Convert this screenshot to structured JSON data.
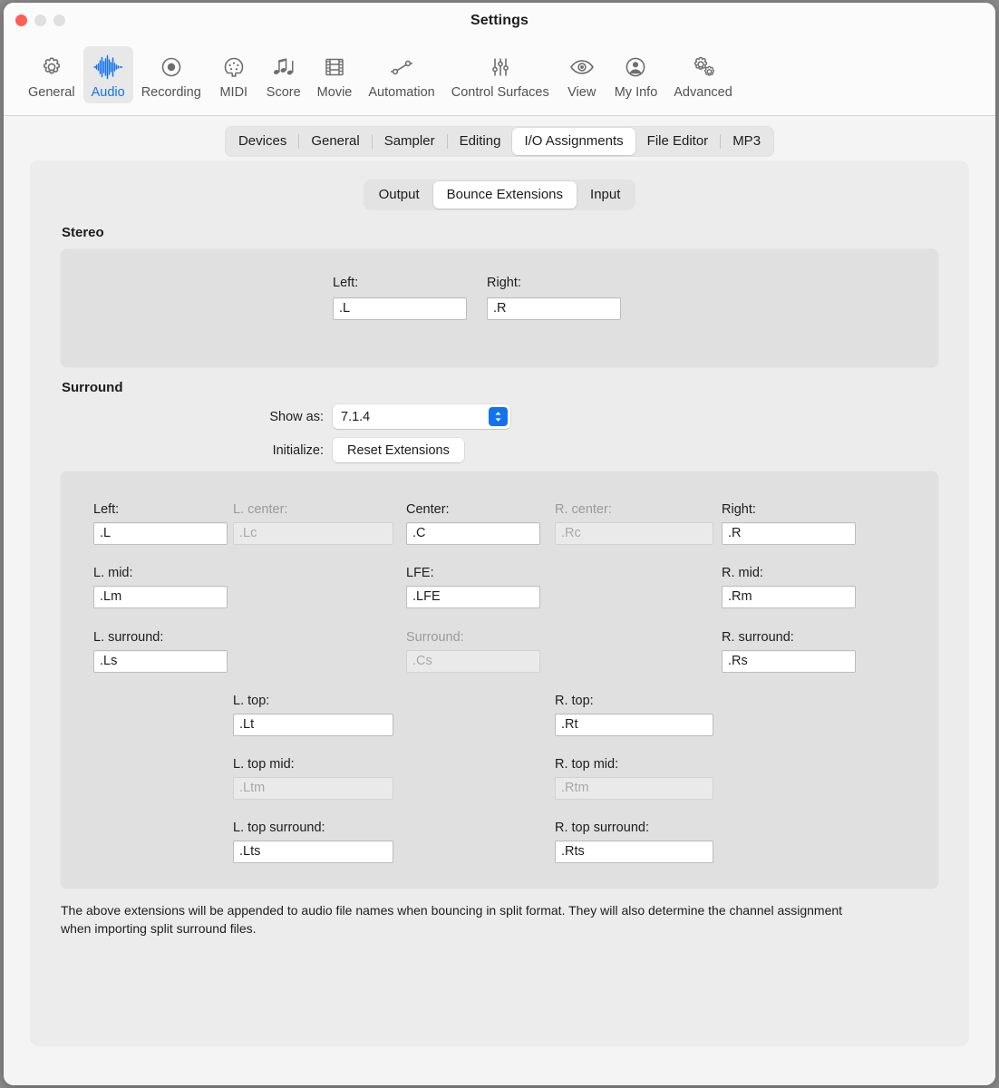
{
  "window": {
    "title": "Settings",
    "traffic_lights": [
      "close-button",
      "minimize-button",
      "zoom-button"
    ]
  },
  "toolbar": {
    "items": [
      {
        "label": "General",
        "icon": "gear-icon",
        "selected": false
      },
      {
        "label": "Audio",
        "icon": "waveform-icon",
        "selected": true
      },
      {
        "label": "Recording",
        "icon": "record-circle-icon",
        "selected": false
      },
      {
        "label": "MIDI",
        "icon": "midi-connector-icon",
        "selected": false
      },
      {
        "label": "Score",
        "icon": "music-notes-icon",
        "selected": false
      },
      {
        "label": "Movie",
        "icon": "film-strip-icon",
        "selected": false
      },
      {
        "label": "Automation",
        "icon": "automation-nodes-icon",
        "selected": false
      },
      {
        "label": "Control Surfaces",
        "icon": "sliders-icon",
        "selected": false
      },
      {
        "label": "View",
        "icon": "eye-icon",
        "selected": false
      },
      {
        "label": "My Info",
        "icon": "person-circle-icon",
        "selected": false
      },
      {
        "label": "Advanced",
        "icon": "double-gear-icon",
        "selected": false
      }
    ]
  },
  "top_tabs": {
    "items": [
      {
        "label": "Devices",
        "selected": false
      },
      {
        "label": "General",
        "selected": false
      },
      {
        "label": "Sampler",
        "selected": false
      },
      {
        "label": "Editing",
        "selected": false
      },
      {
        "label": "I/O Assignments",
        "selected": true
      },
      {
        "label": "File Editor",
        "selected": false
      },
      {
        "label": "MP3",
        "selected": false
      }
    ]
  },
  "sub_tabs": {
    "items": [
      {
        "label": "Output",
        "selected": false
      },
      {
        "label": "Bounce Extensions",
        "selected": true
      },
      {
        "label": "Input",
        "selected": false
      }
    ]
  },
  "stereo": {
    "title": "Stereo",
    "left": {
      "label": "Left:",
      "value": ".L",
      "enabled": true
    },
    "right": {
      "label": "Right:",
      "value": ".R",
      "enabled": true
    }
  },
  "surround": {
    "title": "Surround",
    "show_as": {
      "label": "Show as:",
      "value": "7.1.4"
    },
    "initialize": {
      "label": "Initialize:",
      "button": "Reset Extensions"
    },
    "fields": [
      {
        "key": "left",
        "label": "Left:",
        "value": ".L",
        "enabled": true
      },
      {
        "key": "l_center",
        "label": "L. center:",
        "value": ".Lc",
        "enabled": false
      },
      {
        "key": "center",
        "label": "Center:",
        "value": ".C",
        "enabled": true
      },
      {
        "key": "r_center",
        "label": "R. center:",
        "value": ".Rc",
        "enabled": false
      },
      {
        "key": "right",
        "label": "Right:",
        "value": ".R",
        "enabled": true
      },
      {
        "key": "l_mid",
        "label": "L. mid:",
        "value": ".Lm",
        "enabled": true
      },
      {
        "key": "lfe",
        "label": "LFE:",
        "value": ".LFE",
        "enabled": true
      },
      {
        "key": "r_mid",
        "label": "R. mid:",
        "value": ".Rm",
        "enabled": true
      },
      {
        "key": "l_surround",
        "label": "L. surround:",
        "value": ".Ls",
        "enabled": true
      },
      {
        "key": "surround",
        "label": "Surround:",
        "value": ".Cs",
        "enabled": false
      },
      {
        "key": "r_surround",
        "label": "R. surround:",
        "value": ".Rs",
        "enabled": true
      },
      {
        "key": "l_top",
        "label": "L. top:",
        "value": ".Lt",
        "enabled": true
      },
      {
        "key": "r_top",
        "label": "R. top:",
        "value": ".Rt",
        "enabled": true
      },
      {
        "key": "l_top_mid",
        "label": "L. top mid:",
        "value": ".Ltm",
        "enabled": false
      },
      {
        "key": "r_top_mid",
        "label": "R. top mid:",
        "value": ".Rtm",
        "enabled": false
      },
      {
        "key": "l_top_surround",
        "label": "L. top surround:",
        "value": ".Lts",
        "enabled": true
      },
      {
        "key": "r_top_surround",
        "label": "R. top surround:",
        "value": ".Rts",
        "enabled": true
      }
    ]
  },
  "note": "The above extensions will be appended to audio file names when bouncing in split format. They will also determine the channel assignment when importing split surround files.",
  "colors": {
    "accent": "#1273f0",
    "close": "#ff5f52",
    "window_bg": "#f4f4f4",
    "panel_bg": "#ececec",
    "group_bg": "#e0e0e0"
  }
}
